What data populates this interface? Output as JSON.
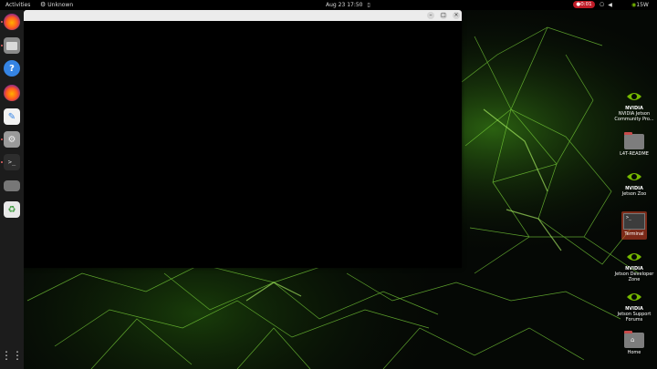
{
  "topbar": {
    "activities": "Activities",
    "app_name": "Unknown",
    "date": "Aug 23",
    "time": "17:50",
    "recording": "0:01",
    "power_label": "15W"
  },
  "desktop": {
    "icons": [
      {
        "label": "NVIDIA Jetson Community Pro...",
        "logo": "NVIDIA"
      },
      {
        "label": "L4T-README"
      },
      {
        "label": "Jetson Zoo",
        "logo": "NVIDIA"
      },
      {
        "label": "Terminal"
      },
      {
        "label": "Jetson Developer Zone",
        "logo": "NVIDIA"
      },
      {
        "label": "Jetson Support Forums",
        "logo": "NVIDIA"
      },
      {
        "label": "Home"
      }
    ]
  },
  "dock": {
    "items": [
      "firefox-icon",
      "files-icon",
      "help-icon",
      "firefox-icon",
      "text-editor-icon",
      "settings-icon",
      "terminal-icon",
      "drive-icon",
      "trash-icon",
      "app-grid-icon"
    ]
  },
  "colors": {
    "accent_green": "#76b900",
    "record_red": "#c01c28",
    "topbar": "#000000",
    "dock": "#1c1c1c"
  },
  "window": {
    "minimize": "–",
    "maximize": "□",
    "close": "×"
  }
}
